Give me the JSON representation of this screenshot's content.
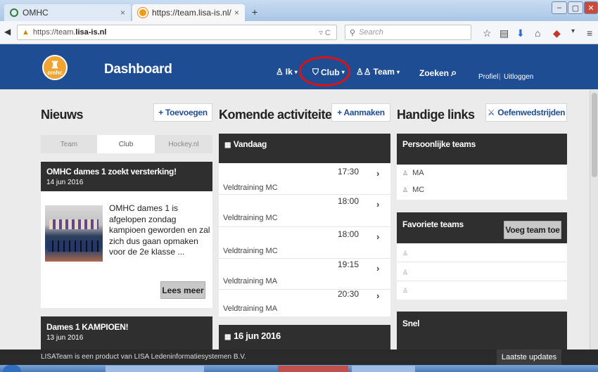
{
  "browser": {
    "tabs": [
      {
        "label": "OMHC",
        "close": "×"
      },
      {
        "label": "https://team.lisa-is.nl/",
        "close": "×"
      }
    ],
    "new_tab": "+",
    "url_prefix": "https://team.",
    "url_domain": "lisa-is.nl",
    "search_placeholder": "Search"
  },
  "header": {
    "logo_text": "omhc",
    "title": "Dashboard",
    "menu": [
      {
        "label": "Ik",
        "icon": "shirt-icon"
      },
      {
        "label": "Club",
        "icon": "shield-icon"
      },
      {
        "label": "Team",
        "icon": "shirts-icon"
      },
      {
        "label": "Zoeken",
        "icon": "search-icon"
      }
    ],
    "profiel": "Profiel",
    "separator": "|",
    "uitloggen": "Uitloggen"
  },
  "nieuws": {
    "title": "Nieuws",
    "add_button": "+ Toevoegen",
    "tabs": [
      "Team",
      "Club",
      "Hockey.nl"
    ],
    "articles": [
      {
        "title": "OMHC dames 1 zoekt versterking!",
        "date": "14 jun 2016",
        "body": "OMHC dames 1 is afgelopen zondag kampioen geworden en zal zich dus gaan opmaken voor de 2e klasse ...",
        "button": "Lees meer"
      },
      {
        "title": "Dames 1 KAMPIOEN!",
        "date": "13 jun 2016"
      }
    ]
  },
  "activiteiten": {
    "title": "Komende activiteiten",
    "add_button": "+ Aanmaken",
    "today_header": "Vandaag",
    "items": [
      {
        "time": "17:30",
        "name": "Veldtraining MC"
      },
      {
        "time": "18:00",
        "name": "Veldtraining MC"
      },
      {
        "time": "18:00",
        "name": "Veldtraining MC"
      },
      {
        "time": "19:15",
        "name": "Veldtraining MA"
      },
      {
        "time": "20:30",
        "name": "Veldtraining MA"
      }
    ],
    "next_header": "16 jun 2016"
  },
  "links": {
    "title": "Handige links",
    "oefen_button": "Oefenwedstrijden",
    "persoonlijk_header": "Persoonlijke teams",
    "persoonlijk": [
      "MA",
      "MC"
    ],
    "favoriet_header": "Favoriete teams",
    "voeg_button": "Voeg team toe",
    "snel_header": "Snel"
  },
  "footer": {
    "text": "LISATeam is een product van LISA Ledeninformatiesystemen B.V.",
    "updates": "Laatste updates"
  },
  "colors": {
    "brand": "#1f4d94",
    "annotation": "#e01010",
    "dark": "#2f2f2f"
  }
}
